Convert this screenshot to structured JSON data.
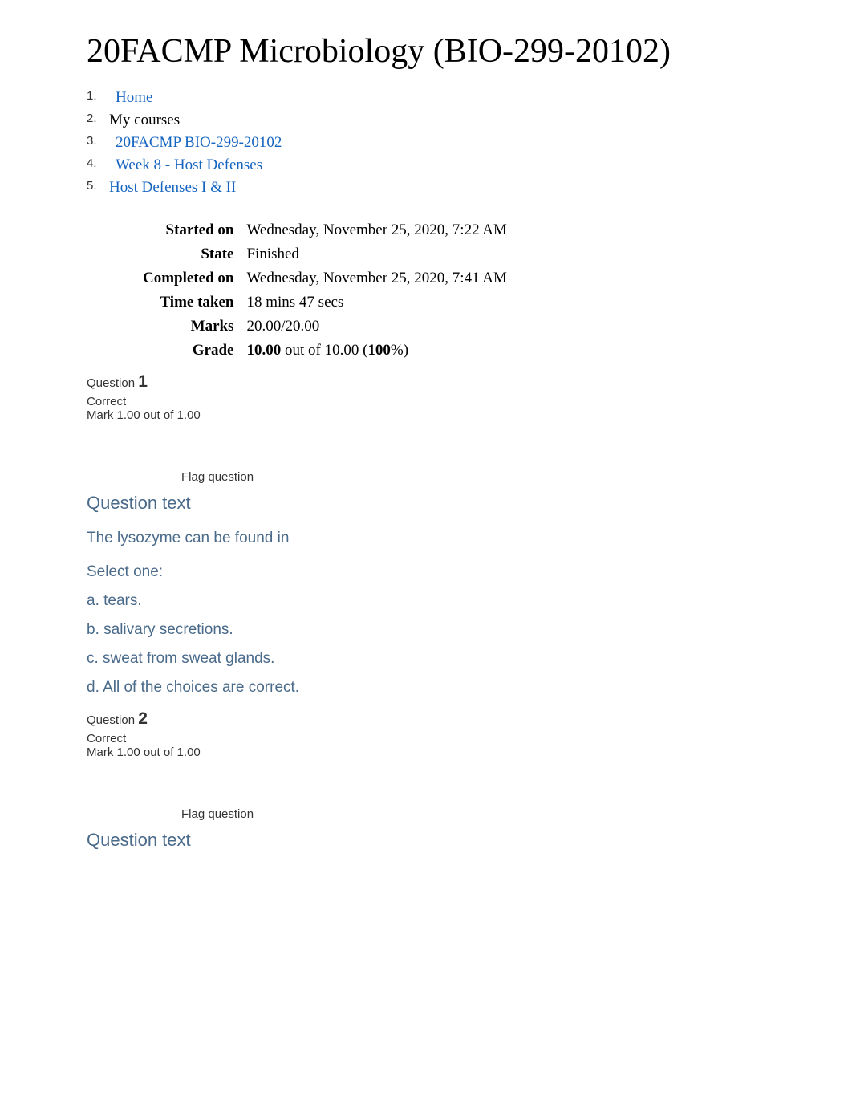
{
  "page_title": "20FACMP Microbiology (BIO-299-20102)",
  "breadcrumb": {
    "items": [
      {
        "num": "1",
        "label": "Home",
        "link": true,
        "indent": true
      },
      {
        "num": "2",
        "label": "My courses",
        "link": false,
        "indent": false
      },
      {
        "num": "3",
        "label": "20FACMP BIO-299-20102",
        "link": true,
        "indent": true
      },
      {
        "num": "4",
        "label": "Week 8 - Host Defenses",
        "link": true,
        "indent": true
      },
      {
        "num": "5",
        "label": "Host Defenses I & II",
        "link": true,
        "indent": false
      }
    ]
  },
  "summary": {
    "started_on_label": "Started on",
    "started_on_value": "Wednesday, November 25, 2020, 7:22 AM",
    "state_label": "State",
    "state_value": "Finished",
    "completed_on_label": "Completed on",
    "completed_on_value": "Wednesday, November 25, 2020, 7:41 AM",
    "time_taken_label": "Time taken",
    "time_taken_value": "18 mins 47 secs",
    "marks_label": "Marks",
    "marks_value": "20.00/20.00",
    "grade_label": "Grade",
    "grade_bold1": "10.00",
    "grade_mid": " out of 10.00 (",
    "grade_bold2": "100",
    "grade_end": "%)"
  },
  "common": {
    "question_word": "Question ",
    "flag_text": "Flag question",
    "qtext_heading": "Question text",
    "select_one": "Select one:"
  },
  "q1": {
    "number": "1",
    "status": "Correct",
    "mark": "Mark 1.00 out of 1.00",
    "prompt": "The lysozyme can be found in",
    "options": {
      "a": "a. tears.",
      "b": "b. salivary secretions.",
      "c": "c. sweat from sweat glands.",
      "d": "d. All of the choices are correct."
    }
  },
  "q2": {
    "number": "2",
    "status": "Correct",
    "mark": "Mark 1.00 out of 1.00"
  }
}
